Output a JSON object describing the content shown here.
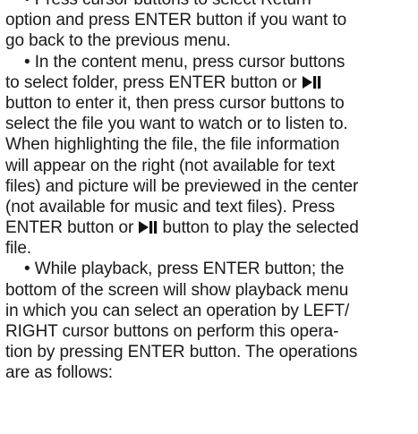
{
  "bullet_1": {
    "line_1": "• Press cursor buttons to select Return",
    "line_2": "option and press ENTER button if you want to",
    "line_3": "go back to the previous menu."
  },
  "bullet_2": {
    "line_1": "• In the content menu, press cursor buttons",
    "line_2_before_icon": "to select folder, press ENTER button or ",
    "line_3_after_icon": "button to enter it, then press cursor buttons to",
    "line_4": "select the file you want to watch or to listen to.",
    "line_5": "When highlighting the file, the file information",
    "line_6": "will appear on the right (not available for text",
    "line_7": "files) and picture will be previewed in the center",
    "line_8": "(not available for music and text files). Press",
    "line_9_before_icon": "ENTER button or ",
    "line_9_after_icon": " button to play the selected",
    "line_10": "file."
  },
  "bullet_3": {
    "line_1": "• While playback, press ENTER button; the",
    "line_2": "bottom of the screen will show playback menu",
    "line_3": "in which you can select an operation by LEFT/",
    "line_4": "RIGHT cursor buttons on perform this opera-",
    "line_5": "tion by pressing ENTER button. The operations",
    "line_6": "are as follows:"
  },
  "icons": {
    "play_pause": "play-pause-icon"
  }
}
